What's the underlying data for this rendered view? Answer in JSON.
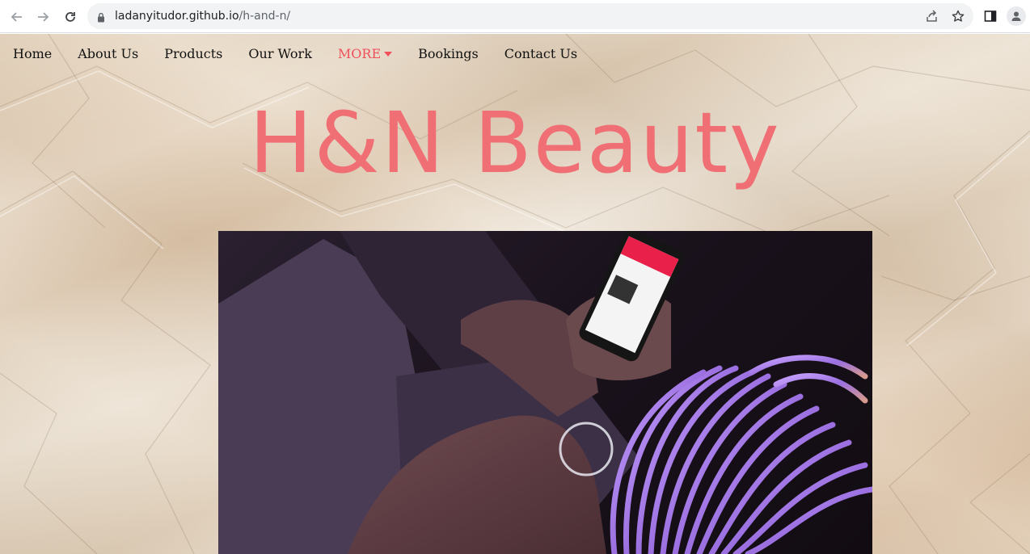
{
  "browser": {
    "url_host": "ladanyitudor.github.io",
    "url_path": "/h-and-n/",
    "icons": [
      "back-icon",
      "forward-icon",
      "reload-icon",
      "lock-icon",
      "share-icon",
      "star-icon",
      "side-panel-icon",
      "profile-icon"
    ]
  },
  "nav": {
    "items": [
      {
        "label": "Home"
      },
      {
        "label": "About Us"
      },
      {
        "label": "Products"
      },
      {
        "label": "Our Work"
      },
      {
        "label": "MORE"
      },
      {
        "label": "Bookings"
      },
      {
        "label": "Contact Us"
      }
    ]
  },
  "hero": {
    "brand": "H&N Beauty"
  },
  "colors": {
    "accent": "#f0505a",
    "brand": "#ef6f75",
    "paper": "#e6d8c4"
  }
}
